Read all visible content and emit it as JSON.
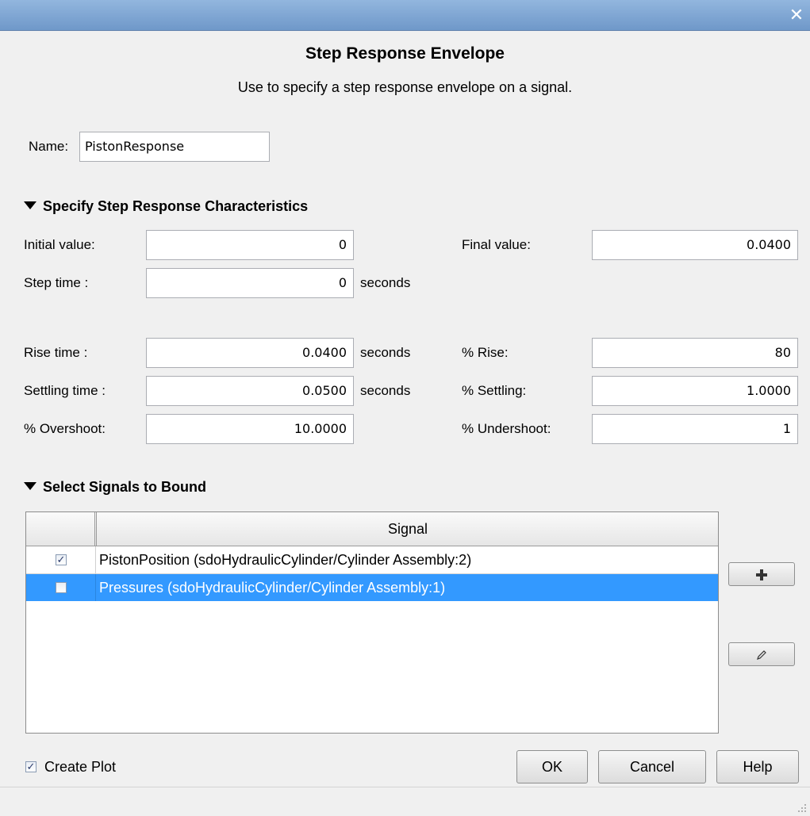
{
  "window": {
    "close_glyph": "✕"
  },
  "header": {
    "title": "Step Response Envelope",
    "subtitle": "Use to specify a step response envelope on a signal."
  },
  "name": {
    "label": "Name:",
    "value": "PistonResponse"
  },
  "characteristics": {
    "section_title": "Specify Step Response Characteristics",
    "initial_value": {
      "label": "Initial value:",
      "value": "0"
    },
    "final_value": {
      "label": "Final value:",
      "value": "0.0400"
    },
    "step_time": {
      "label": "Step time :",
      "value": "0",
      "unit": "seconds"
    },
    "rise_time": {
      "label": "Rise time :",
      "value": "0.0400",
      "unit": "seconds"
    },
    "percent_rise": {
      "label": "% Rise:",
      "value": "80"
    },
    "settling_time": {
      "label": "Settling time :",
      "value": "0.0500",
      "unit": "seconds"
    },
    "percent_settling": {
      "label": "% Settling:",
      "value": "1.0000"
    },
    "percent_overshoot": {
      "label": "% Overshoot:",
      "value": "10.0000"
    },
    "percent_undershoot": {
      "label": "% Undershoot:",
      "value": "1"
    }
  },
  "signals": {
    "section_title": "Select Signals to Bound",
    "column_header": "Signal",
    "rows": [
      {
        "checked": true,
        "name": "PistonPosition (sdoHydraulicCylinder/Cylinder Assembly:2)",
        "selected": false
      },
      {
        "checked": false,
        "name": "Pressures (sdoHydraulicCylinder/Cylinder Assembly:1)",
        "selected": true
      }
    ],
    "add_icon": "plus-icon",
    "edit_icon": "pencil-icon"
  },
  "footer": {
    "create_plot_label": "Create Plot",
    "create_plot_checked": true,
    "ok_label": "OK",
    "cancel_label": "Cancel",
    "help_label": "Help"
  },
  "colors": {
    "selection": "#3399ff",
    "titlebar": "#7fa6d6"
  }
}
